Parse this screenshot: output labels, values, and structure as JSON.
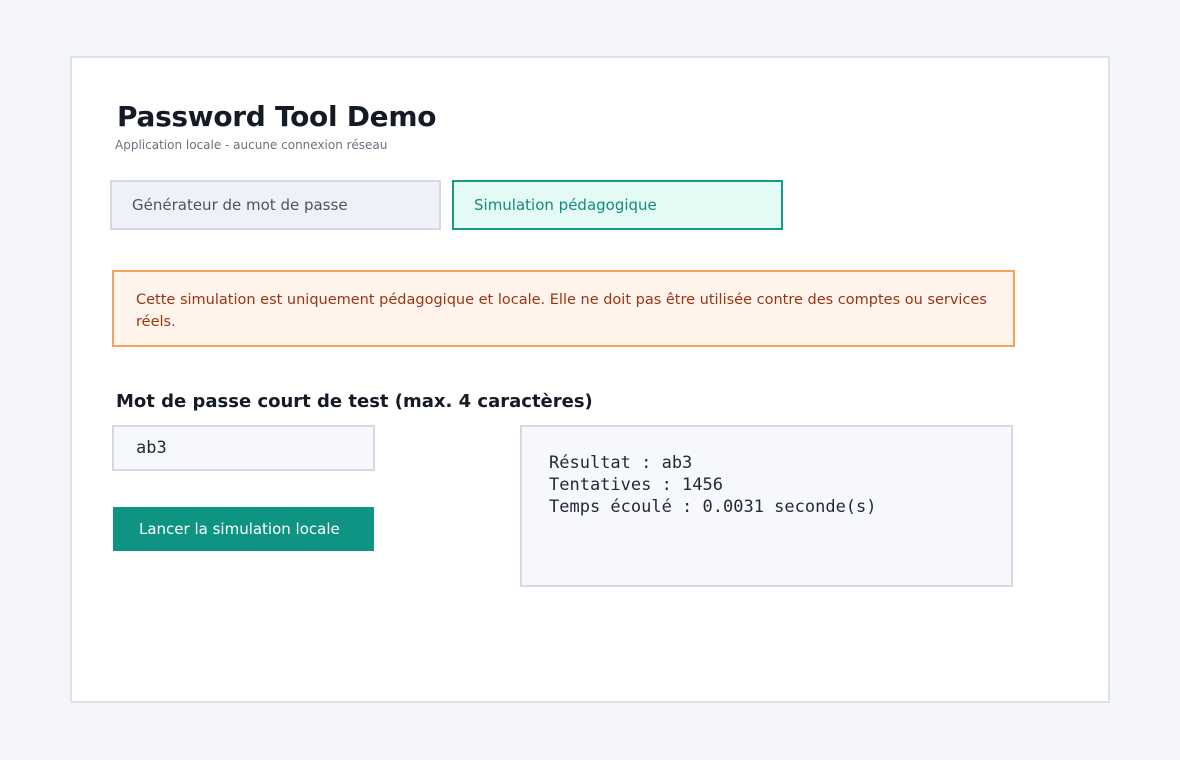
{
  "app": {
    "title": "Password Tool Demo",
    "subtitle": "Application locale - aucune connexion réseau"
  },
  "tabs": [
    {
      "label": "Générateur de mot de passe",
      "active": false
    },
    {
      "label": "Simulation pédagogique",
      "active": true
    }
  ],
  "warning": {
    "text": "Cette simulation est uniquement pédagogique et locale. Elle ne doit pas être utilisée contre des comptes ou services réels."
  },
  "form": {
    "label": "Mot de passe court de test (max. 4 caractères)",
    "value": "ab3",
    "button_label": "Lancer la simulation locale"
  },
  "result": {
    "lines": [
      "Résultat : ab3",
      "Tentatives : 1456",
      "Temps écoulé : 0.0031 seconde(s)"
    ]
  },
  "colors": {
    "accent": "#0f9483",
    "warning_border": "#f4a45a",
    "warning_bg": "#fff4eb",
    "warning_text": "#9a3412"
  }
}
